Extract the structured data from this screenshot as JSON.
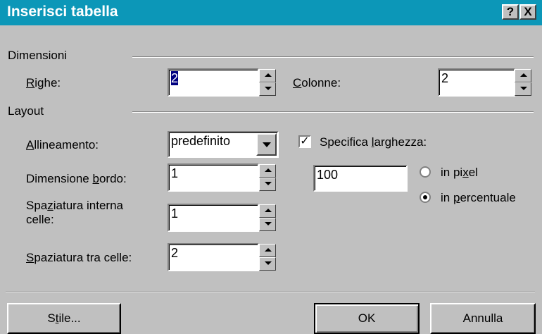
{
  "dialog": {
    "title": "Inserisci tabella",
    "help_label": "?",
    "close_label": "X"
  },
  "dimensioni": {
    "section_label": "Dimensioni",
    "righe_label": "Righe:",
    "righe_value": "2",
    "colonne_label": "Colonne:",
    "colonne_value": "2"
  },
  "layout": {
    "section_label": "Layout",
    "allineamento_label": "Allineamento:",
    "allineamento_value": "predefinito",
    "bordo_label": "Dimensione bordo:",
    "bordo_value": "1",
    "spaziatura_interna_label_line1": "Spaziatura interna",
    "spaziatura_interna_label_line2": "celle:",
    "spaziatura_interna_value": "1",
    "spaziatura_tra_label": "Spaziatura tra celle:",
    "spaziatura_tra_value": "2",
    "specifica_label": "Specifica larghezza:",
    "specifica_checked": true,
    "larghezza_value": "100",
    "radio_pixel_label": "in pixel",
    "radio_percent_label": "in percentuale",
    "selected_unit": "percentuale"
  },
  "buttons": {
    "stile": "Stile...",
    "ok": "OK",
    "annulla": "Annulla"
  },
  "colors": {
    "titlebar": "#0c97b8",
    "face": "#c0c0c0"
  }
}
